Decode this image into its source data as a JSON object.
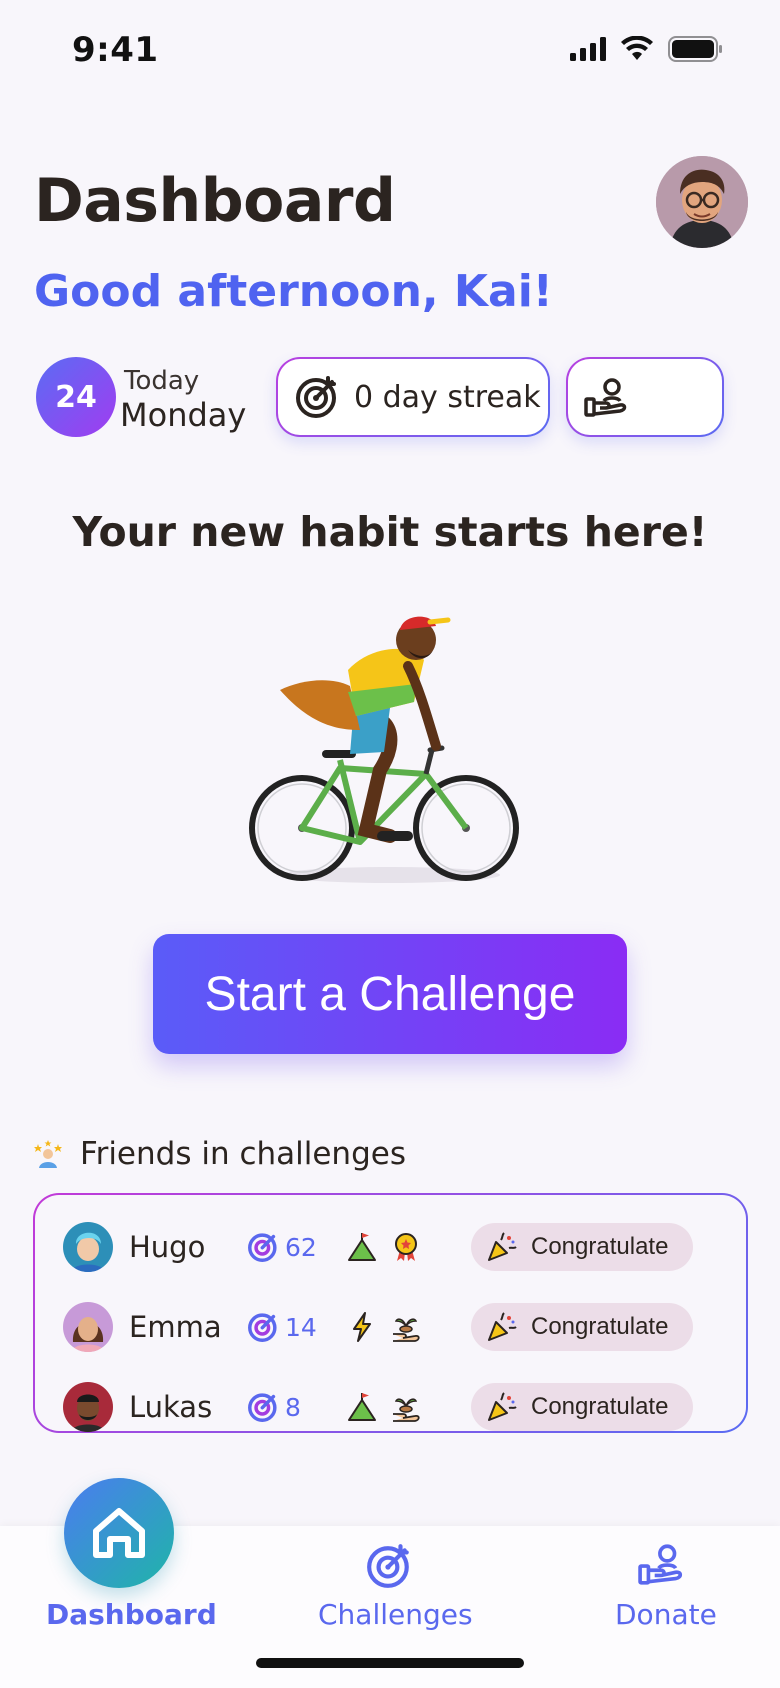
{
  "status_bar": {
    "time": "9:41"
  },
  "header": {
    "title": "Dashboard",
    "greeting": "Good afternoon, Kai!"
  },
  "date": {
    "day_number": "24",
    "today_label": "Today",
    "weekday": "Monday"
  },
  "streak": {
    "label": "0 day streak"
  },
  "headline": "Your new habit starts here!",
  "cta": {
    "label": "Start a Challenge"
  },
  "friends": {
    "title": "Friends in challenges",
    "rows": [
      {
        "name": "Hugo",
        "streak": "62",
        "badges": [
          "mountain-flag-icon",
          "medal-icon"
        ],
        "action": "Congratulate"
      },
      {
        "name": "Emma",
        "streak": "14",
        "badges": [
          "lightning-icon",
          "plant-hand-icon"
        ],
        "action": "Congratulate"
      },
      {
        "name": "Lukas",
        "streak": "8",
        "badges": [
          "mountain-flag-icon",
          "plant-hand-icon"
        ],
        "action": "Congratulate"
      }
    ]
  },
  "tabs": [
    {
      "label": "Dashboard",
      "icon": "home-icon",
      "active": true
    },
    {
      "label": "Challenges",
      "icon": "target-icon",
      "active": false
    },
    {
      "label": "Donate",
      "icon": "donate-hand-icon",
      "active": false
    }
  ],
  "colors": {
    "accent": "#4f63f0",
    "gradient_start": "#5a5cf8",
    "gradient_end": "#8a2cf4",
    "congratulate_bg": "#ecdde8",
    "home_gradient_start": "#4b7cf0",
    "home_gradient_end": "#1fb5a8"
  }
}
